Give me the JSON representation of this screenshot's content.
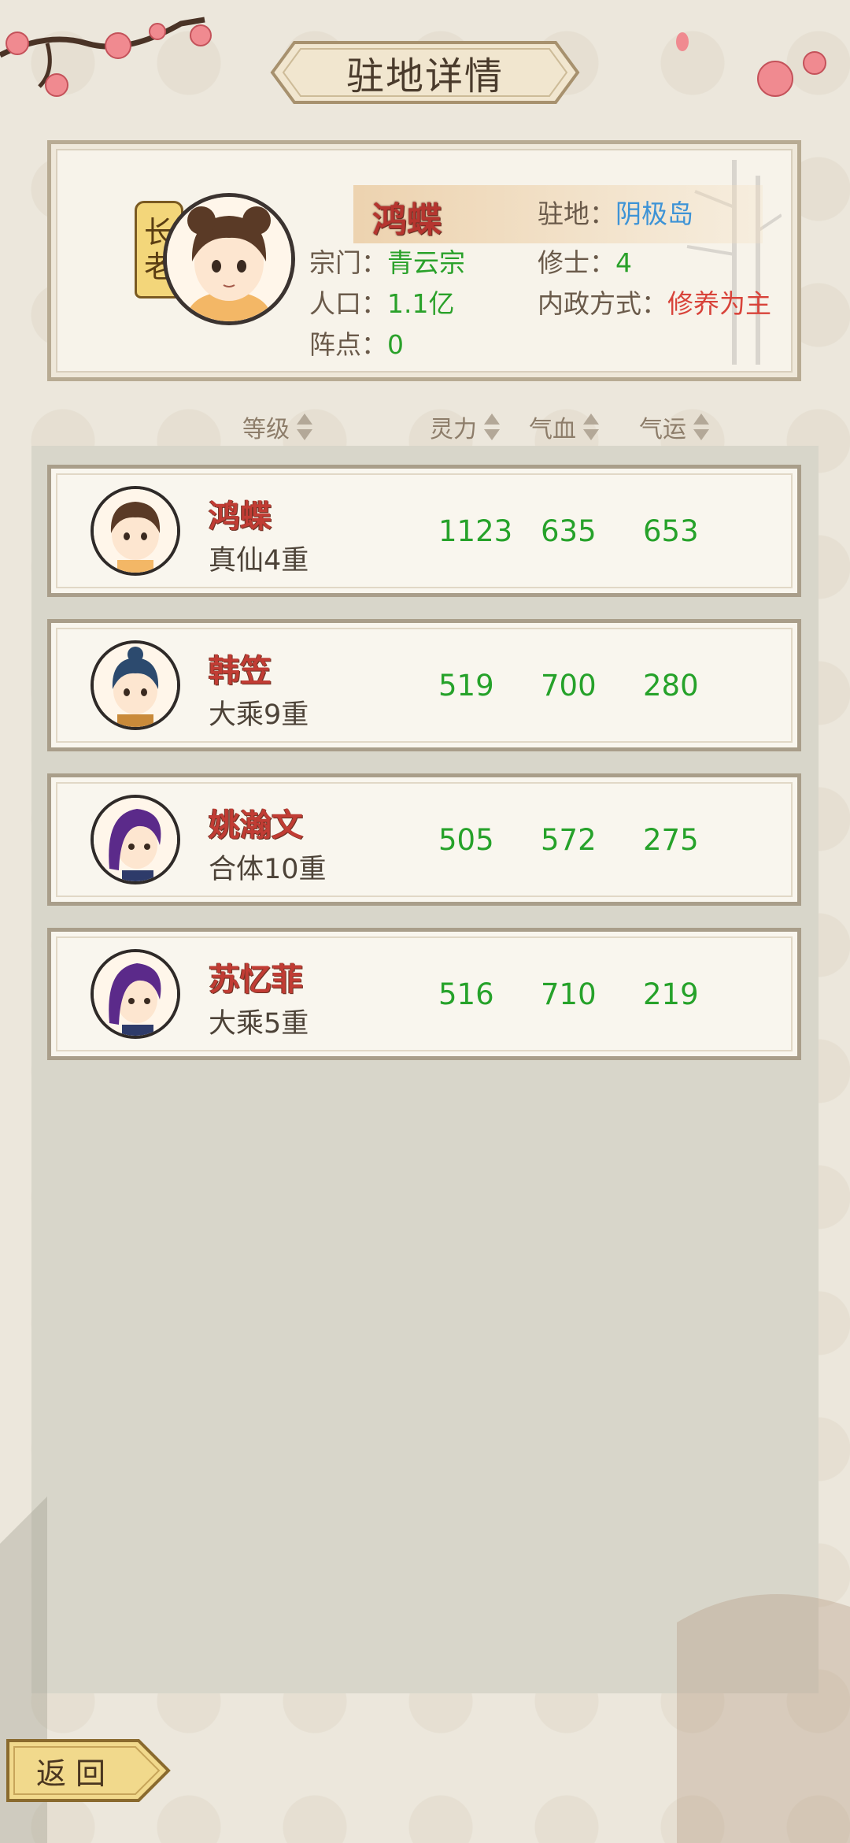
{
  "header": {
    "title": "驻地详情"
  },
  "leader": {
    "rank_tag_top": "长",
    "rank_tag_bottom": "老",
    "name": "鸿蝶",
    "station_label": "驻地：",
    "station_value": "阴极岛",
    "sect_label": "宗门：",
    "sect_value": "青云宗",
    "cultivators_label": "修士：",
    "cultivators_value": "4",
    "population_label": "人口：",
    "population_value": "1.1亿",
    "governance_label": "内政方式：",
    "governance_value": "修养为主",
    "formation_label": "阵点：",
    "formation_value": "0"
  },
  "columns": {
    "level": "等级",
    "spirit": "灵力",
    "blood": "气血",
    "luck": "气运"
  },
  "members": [
    {
      "name": "鸿蝶",
      "level": "真仙4重",
      "spirit": "1123",
      "blood": "635",
      "luck": "653",
      "hair": "#5a3a26"
    },
    {
      "name": "韩笠",
      "level": "大乘9重",
      "spirit": "519",
      "blood": "700",
      "luck": "280",
      "hair": "#2c4a6e"
    },
    {
      "name": "姚瀚文",
      "level": "合体10重",
      "spirit": "505",
      "blood": "572",
      "luck": "275",
      "hair": "#5b2a8a"
    },
    {
      "name": "苏忆菲",
      "level": "大乘5重",
      "spirit": "516",
      "blood": "710",
      "luck": "219",
      "hair": "#5b2a8a"
    }
  ],
  "footer": {
    "back_label": "返回"
  },
  "colors": {
    "name_red": "#c13c34",
    "stat_green": "#26a22a",
    "station_blue": "#3d93d6"
  }
}
